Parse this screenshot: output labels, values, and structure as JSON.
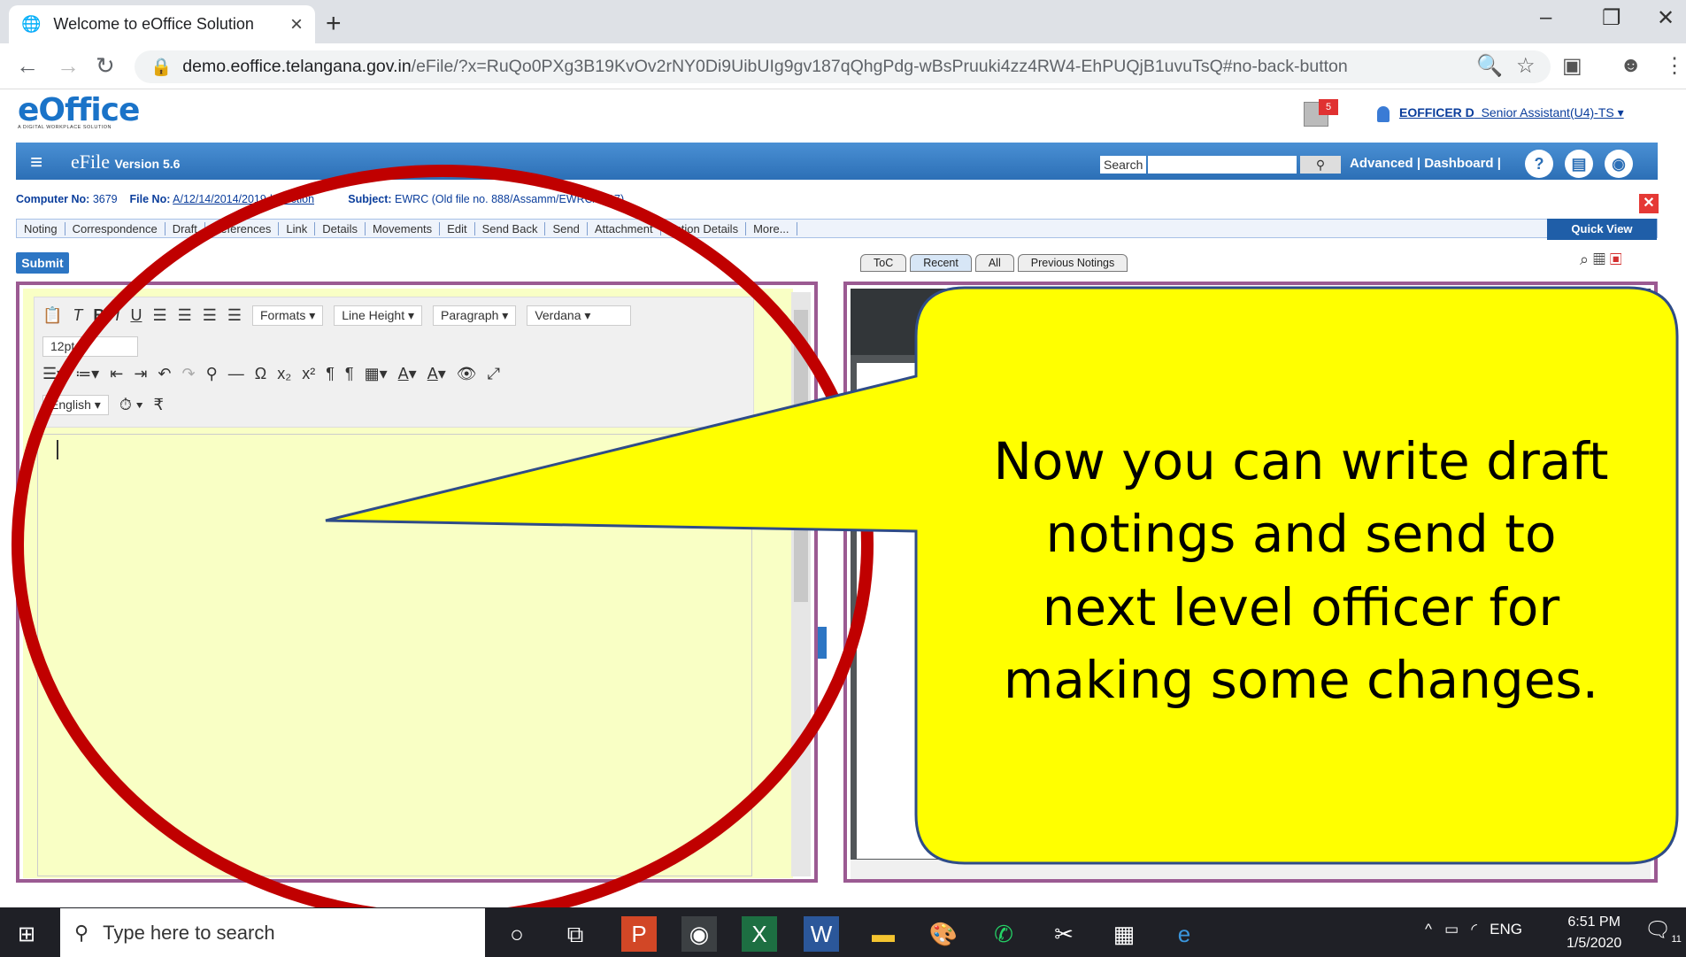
{
  "browser": {
    "tab_title": "Welcome to eOffice Solution",
    "tab_close": "×",
    "new_tab": "+",
    "url_domain": "demo.eoffice.telangana.gov.in",
    "url_path": "/eFile/?x=RuQo0PXg3B19KvOv2rNY0Di9UibUIg9gv187qQhgPdg-wBsPruuki4zz4RW4-EhPUQjB1uvuTsQ#no-back-button",
    "minimize": "–",
    "restore": "❐",
    "close": "✕"
  },
  "header": {
    "logo": "eOffice",
    "logo_tagline": "A DIGITAL WORKPLACE SOLUTION",
    "mail_count": "5",
    "user_name": "EOFFICER D",
    "user_role": "Senior Assistant(U4)-TS"
  },
  "appbar": {
    "title": "eFile",
    "version": "Version 5.6",
    "search_label": "Search",
    "links": "Advanced  |  Dashboard  |"
  },
  "file_info": {
    "computer_no_label": "Computer No:",
    "computer_no": "3679",
    "file_no_label": "File No:",
    "file_no": "A/12/14/2014/2019-b section",
    "subject_label": "Subject:",
    "subject": "EWRC (Old file no. 888/Assamm/EWRC/2017)"
  },
  "menu": {
    "items": [
      "Noting",
      "Correspondence",
      "Draft",
      "References",
      "Link",
      "Details",
      "Movements",
      "Edit",
      "Send Back",
      "Send",
      "Attachment",
      "Action Details",
      "More..."
    ],
    "quick_view": "Quick View"
  },
  "submit_label": "Submit",
  "right_tabs": [
    "ToC",
    "Recent",
    "All",
    "Previous Notings"
  ],
  "editor": {
    "formats": "Formats",
    "line_height": "Line Height",
    "paragraph": "Paragraph",
    "font": "Verdana",
    "font_size": "12pt",
    "language": "English"
  },
  "callout": {
    "text": "Now you can write draft\nnotings  and send to\nnext level officer for\nmaking some changes."
  },
  "taskbar": {
    "search_placeholder": "Type here to search",
    "lang": "ENG",
    "time": "6:51 PM",
    "date": "1/5/2020",
    "notif_count": "11"
  },
  "colors": {
    "editor_bg": "#f9ffc5",
    "panel_border": "#9b5a92",
    "callout_fill": "#ffff00",
    "circle": "#c00000"
  }
}
